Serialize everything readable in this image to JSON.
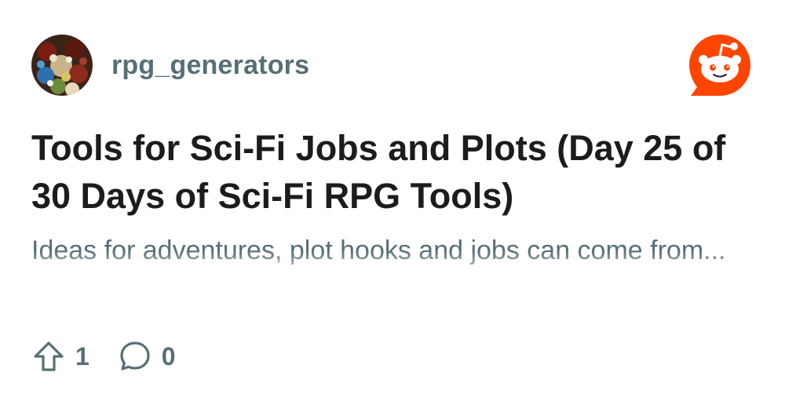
{
  "post": {
    "author": "rpg_generators",
    "title": "Tools for Sci-Fi Jobs and Plots (Day 25 of 30 Days of Sci-Fi RPG Tools)",
    "excerpt": "Ideas for adventures, plot hooks and jobs can come from..."
  },
  "stats": {
    "upvotes": "1",
    "comments": "0"
  },
  "icons": {
    "avatar": "dice-collection-avatar",
    "brand": "reddit-logo-icon",
    "upvote": "upvote-arrow-icon",
    "comment": "comment-bubble-icon"
  },
  "colors": {
    "brand": "#ff4500",
    "muted_text": "#576f76",
    "title_text": "#1c1c1c"
  }
}
